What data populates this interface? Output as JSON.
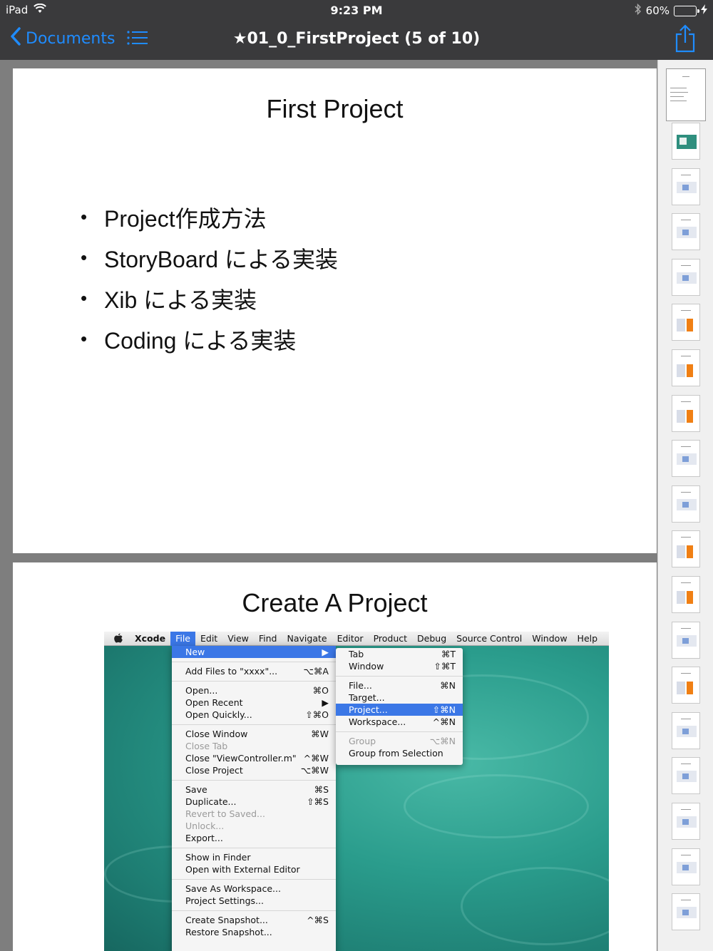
{
  "status": {
    "device": "iPad",
    "time": "9:23 PM",
    "battery_text": "60%",
    "battery_level": 0.6
  },
  "nav": {
    "back_label": "Documents",
    "title": "★01_0_FirstProject (5 of 10)"
  },
  "colors": {
    "accent": "#1f8cff",
    "bar_bg": "#3a3a3c",
    "menu_highlight": "#3b77e6",
    "battery_green": "#4cd964"
  },
  "icons": {
    "back": "chevron-left-icon",
    "list": "list-icon",
    "share": "share-icon",
    "wifi": "wifi-icon",
    "bluetooth": "bluetooth-icon",
    "charging": "bolt-icon"
  },
  "slide1": {
    "title": "First Project",
    "bullets": [
      "Project作成方法",
      "StoryBoard による実装",
      "Xib による実装",
      "Coding による実装"
    ]
  },
  "slide2": {
    "title": "Create A Project",
    "menubar": [
      "Xcode",
      "File",
      "Edit",
      "View",
      "Find",
      "Navigate",
      "Editor",
      "Product",
      "Debug",
      "Source Control",
      "Window",
      "Help"
    ],
    "file_menu": [
      {
        "label": "New",
        "shortcut": "▶",
        "highlight": true
      },
      {
        "sep": true
      },
      {
        "label": "Add Files to \"xxxx\"...",
        "shortcut": "⌥⌘A"
      },
      {
        "sep": true
      },
      {
        "label": "Open...",
        "shortcut": "⌘O"
      },
      {
        "label": "Open Recent",
        "shortcut": "▶"
      },
      {
        "label": "Open Quickly...",
        "shortcut": "⇧⌘O"
      },
      {
        "sep": true
      },
      {
        "label": "Close Window",
        "shortcut": "⌘W"
      },
      {
        "label": "Close Tab",
        "shortcut": "",
        "disabled": true
      },
      {
        "label": "Close \"ViewController.m\"",
        "shortcut": "^⌘W"
      },
      {
        "label": "Close Project",
        "shortcut": "⌥⌘W"
      },
      {
        "sep": true
      },
      {
        "label": "Save",
        "shortcut": "⌘S"
      },
      {
        "label": "Duplicate...",
        "shortcut": "⇧⌘S"
      },
      {
        "label": "Revert to Saved...",
        "shortcut": "",
        "disabled": true
      },
      {
        "label": "Unlock...",
        "shortcut": "",
        "disabled": true
      },
      {
        "label": "Export...",
        "shortcut": ""
      },
      {
        "sep": true
      },
      {
        "label": "Show in Finder",
        "shortcut": ""
      },
      {
        "label": "Open with External Editor",
        "shortcut": ""
      },
      {
        "sep": true
      },
      {
        "label": "Save As Workspace...",
        "shortcut": ""
      },
      {
        "label": "Project Settings...",
        "shortcut": ""
      },
      {
        "sep": true
      },
      {
        "label": "Create Snapshot...",
        "shortcut": "^⌘S"
      },
      {
        "label": "Restore Snapshot...",
        "shortcut": ""
      }
    ],
    "new_submenu": [
      {
        "label": "Tab",
        "shortcut": "⌘T"
      },
      {
        "label": "Window",
        "shortcut": "⇧⌘T"
      },
      {
        "sep": true
      },
      {
        "label": "File...",
        "shortcut": "⌘N"
      },
      {
        "label": "Target...",
        "shortcut": ""
      },
      {
        "label": "Project...",
        "shortcut": "⇧⌘N",
        "highlight": true
      },
      {
        "label": "Workspace...",
        "shortcut": "^⌘N"
      },
      {
        "sep": true
      },
      {
        "label": "Group",
        "shortcut": "⌥⌘N",
        "disabled": true
      },
      {
        "label": "Group from Selection",
        "shortcut": ""
      }
    ]
  },
  "thumbnails": {
    "count": 19,
    "current_index": 0,
    "kinds": [
      "text",
      "image",
      "screen",
      "screen",
      "screen",
      "orange",
      "orange",
      "orange",
      "screen",
      "screen",
      "orange",
      "orange",
      "screen",
      "orange",
      "screen",
      "screen",
      "screen",
      "screen",
      "screen"
    ]
  }
}
